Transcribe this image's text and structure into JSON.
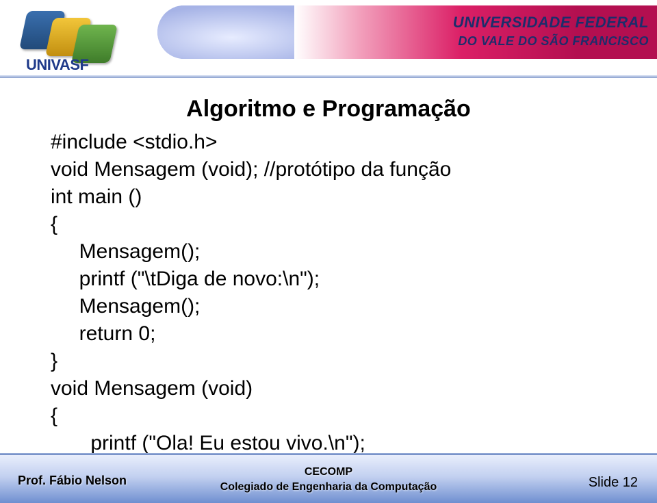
{
  "header": {
    "logo_text": "UNIVASF",
    "university_line1": "UNIVERSIDADE FEDERAL",
    "university_line2": "DO VALE DO SÃO FRANCISCO"
  },
  "title": "Algoritmo e Programação",
  "code": "#include <stdio.h>\nvoid Mensagem (void); //protótipo da função\nint main ()\n{\n     Mensagem();\n     printf (\"\\tDiga de novo:\\n\");\n     Mensagem();\n     return 0;\n}\nvoid Mensagem (void)\n{\n       printf (\"Ola! Eu estou vivo.\\n\");\n}",
  "footer": {
    "author": "Prof. Fábio Nelson",
    "center_line1": "CECOMP",
    "center_line2": "Colegiado de Engenharia da Computação",
    "slide": "Slide 12"
  }
}
